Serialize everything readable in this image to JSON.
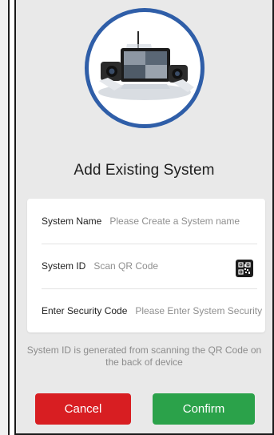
{
  "screen": {
    "title": "Add Existing System"
  },
  "form": {
    "system_name": {
      "label": "System Name",
      "placeholder": "Please Create a System name"
    },
    "system_id": {
      "label": "System ID",
      "placeholder": "Scan QR Code",
      "icon": "qr-code-icon"
    },
    "security_code": {
      "label": "Enter Security Code",
      "placeholder": "Please Enter System Security Code"
    }
  },
  "helper_text": "System ID is generated from scanning the QR Code on the back of device",
  "buttons": {
    "cancel": "Cancel",
    "confirm": "Confirm"
  },
  "colors": {
    "cancel": "#d81e22",
    "confirm": "#2ba24a",
    "ring": "#2f5ea8",
    "background": "#e9e9e9"
  }
}
